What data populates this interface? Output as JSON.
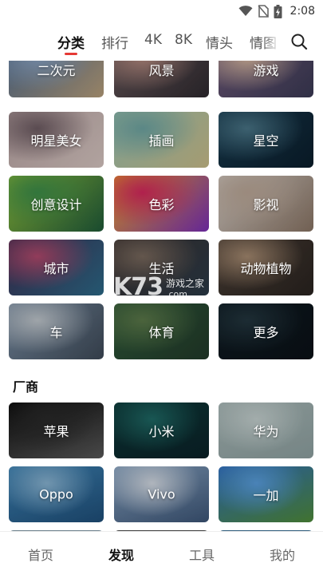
{
  "status_bar": {
    "time": "2:08"
  },
  "tabs": [
    {
      "label": "分类",
      "active": true
    },
    {
      "label": "排行",
      "active": false
    },
    {
      "label": "4K",
      "active": false
    },
    {
      "label": "8K",
      "active": false
    },
    {
      "label": "情头",
      "active": false
    },
    {
      "label": "情图",
      "active": false
    }
  ],
  "categories": [
    {
      "label": "二次元",
      "colors": [
        "#4d6a8e",
        "#8aa3c2",
        "#b9a07c"
      ]
    },
    {
      "label": "风景",
      "colors": [
        "#6a5a5c",
        "#b48a80",
        "#2f2a30"
      ]
    },
    {
      "label": "游戏",
      "colors": [
        "#6f5a7a",
        "#d5b6a0",
        "#3b3a55"
      ]
    },
    {
      "label": "明星美女",
      "colors": [
        "#b8a3a3",
        "#6e5c63",
        "#d9c8c3"
      ]
    },
    {
      "label": "插画",
      "colors": [
        "#9cc3b1",
        "#6fa6a4",
        "#cbbf8b"
      ]
    },
    {
      "label": "星空",
      "colors": [
        "#173a4f",
        "#4a7688",
        "#0b1e2c"
      ]
    },
    {
      "label": "创意设计",
      "colors": [
        "#8fbf3c",
        "#3d8f4a",
        "#1f5b3a"
      ]
    },
    {
      "label": "色彩",
      "colors": [
        "#f2a52a",
        "#d7285e",
        "#7b2fb8"
      ]
    },
    {
      "label": "影视",
      "colors": [
        "#d7cfc8",
        "#bda999",
        "#8a7565"
      ]
    },
    {
      "label": "城市",
      "colors": [
        "#3c2d52",
        "#b24a6e",
        "#2d6b8a"
      ]
    },
    {
      "label": "生活",
      "colors": [
        "#3a3130",
        "#7a6a5e",
        "#2c3b48"
      ]
    },
    {
      "label": "动物植物",
      "colors": [
        "#4a3e36",
        "#a88c72",
        "#2a2420"
      ]
    },
    {
      "label": "车",
      "colors": [
        "#7a8fa6",
        "#c2c9cf",
        "#3e4a58"
      ]
    },
    {
      "label": "体育",
      "colors": [
        "#2f5a3a",
        "#5c7a4a",
        "#223a2a"
      ]
    },
    {
      "label": "更多",
      "colors": [
        "#0f1b22",
        "#23363f",
        "#0a1117"
      ]
    }
  ],
  "vendor_section": {
    "title": "厂商",
    "items": [
      {
        "label": "苹果",
        "colors": [
          "#0b0b0b",
          "#2a2a2a",
          "#5a5a5a"
        ]
      },
      {
        "label": "小米",
        "colors": [
          "#0e3a3a",
          "#1f6a66",
          "#0a2228"
        ]
      },
      {
        "label": "华为",
        "colors": [
          "#a9b9b8",
          "#c7d3d2",
          "#8fa2a2"
        ]
      },
      {
        "label": "Oppo",
        "colors": [
          "#3f86b8",
          "#8ab6d5",
          "#1f4f7a"
        ]
      },
      {
        "label": "Vivo",
        "colors": [
          "#8aa7c6",
          "#d6dde6",
          "#3d5678"
        ]
      },
      {
        "label": "一加",
        "colors": [
          "#2f6fc0",
          "#5aa0e0",
          "#4f8c3a"
        ]
      }
    ]
  },
  "watermark": {
    "logo": "K73",
    "text": "游戏之家",
    "domain": ".com"
  },
  "bottom_nav": [
    {
      "label": "首页",
      "active": false
    },
    {
      "label": "发现",
      "active": true
    },
    {
      "label": "工具",
      "active": false
    },
    {
      "label": "我的",
      "active": false
    }
  ]
}
